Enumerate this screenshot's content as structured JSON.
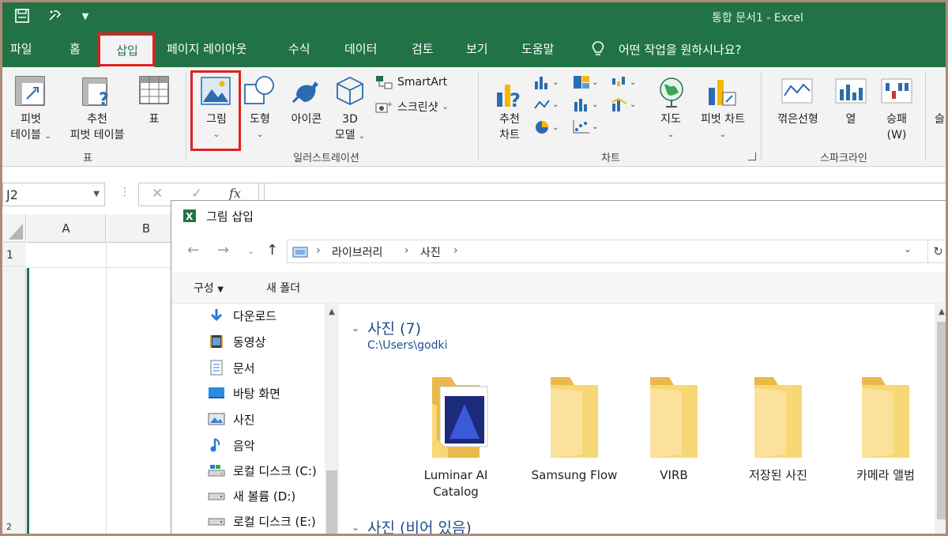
{
  "app": {
    "doc_title": "통합 문서1  -  Excel"
  },
  "quick_access": {
    "icons": [
      "save-icon",
      "touch-mode-icon",
      "customize-icon"
    ]
  },
  "tabs": [
    {
      "label": "파일"
    },
    {
      "label": "홈"
    },
    {
      "label": "삽입"
    },
    {
      "label": "페이지 레이아웃"
    },
    {
      "label": "수식"
    },
    {
      "label": "데이터"
    },
    {
      "label": "검토"
    },
    {
      "label": "보기"
    },
    {
      "label": "도움말"
    }
  ],
  "tell_me": "어떤 작업을 원하시나요?",
  "ribbon": {
    "pivot_line1": "피벗",
    "pivot_line2": "테이블",
    "rec_pivot_line1": "추천",
    "rec_pivot_line2": "피벗 테이블",
    "table": "표",
    "group_table": "표",
    "picture": "그림",
    "shapes": "도형",
    "icons": "아이콘",
    "model_line1": "3D",
    "model_line2": "모델",
    "smartart": "SmartArt",
    "screenshot": "스크린샷",
    "group_illustration": "일러스트레이션",
    "rec_chart_line1": "추천",
    "rec_chart_line2": "차트",
    "map": "지도",
    "pivot_chart": "피벗 차트",
    "group_chart": "차트",
    "spark_line": "꺾은선형",
    "spark_column": "열",
    "spark_winloss_line1": "승패",
    "spark_winloss_line2": "(W)",
    "group_sparkline": "스파크라인",
    "cut_off": "슬"
  },
  "formula_bar": {
    "name_box": "J2",
    "fx": "fx"
  },
  "sheet": {
    "col_a": "A",
    "col_b": "B",
    "row_1": "1",
    "row_2": "2"
  },
  "dialog": {
    "title": "그림 삽입",
    "address_segments": [
      "라이브러리",
      "사진"
    ],
    "organize": "구성",
    "new_folder": "새 폴더",
    "nav_items": [
      {
        "label": "다운로드",
        "icon": "download-icon"
      },
      {
        "label": "동영상",
        "icon": "video-icon"
      },
      {
        "label": "문서",
        "icon": "document-icon"
      },
      {
        "label": "바탕 화면",
        "icon": "desktop-icon"
      },
      {
        "label": "사진",
        "icon": "pictures-icon"
      },
      {
        "label": "음악",
        "icon": "music-icon"
      },
      {
        "label": "로컬 디스크 (C:)",
        "icon": "drive-c-icon"
      },
      {
        "label": "새 볼륨 (D:)",
        "icon": "drive-icon"
      },
      {
        "label": "로컬 디스크 (E:)",
        "icon": "drive-icon"
      }
    ],
    "section_title": "사진 (7)",
    "section_path": "C:\\Users\\godki",
    "folders": [
      {
        "line1": "Luminar AI",
        "line2": "Catalog"
      },
      {
        "line1": "Samsung Flow",
        "line2": ""
      },
      {
        "line1": "VIRB",
        "line2": ""
      },
      {
        "line1": "저장된 사진",
        "line2": ""
      },
      {
        "line1": "카메라 앨범",
        "line2": ""
      }
    ],
    "section2_title": "사진 (비어 있음)"
  },
  "colors": {
    "excel_green": "#217346",
    "highlight_red": "#e02020",
    "folder_yellow": "#f8d775"
  }
}
